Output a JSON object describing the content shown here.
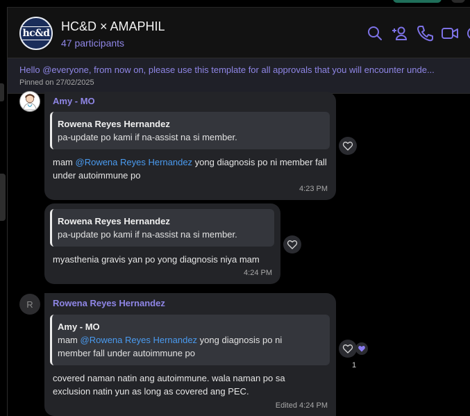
{
  "header": {
    "title": "HC&D × AMAPHIL",
    "participants": "47 participants",
    "avatar_logo": "hc&d",
    "icons": [
      "search-icon",
      "add-person-icon",
      "phone-icon",
      "video-icon",
      "more-icon"
    ]
  },
  "pinned": {
    "text": "Hello @everyone, from now on, please use this template for all approvals that you will encounter unde...",
    "date": "Pinned on 27/02/2025"
  },
  "messages": [
    {
      "sender": "Amy - MO",
      "quote_name": "Rowena Reyes Hernandez",
      "quote_text": "pa-update po kami if na-assist na si member.",
      "text_prefix": "mam ",
      "mention": "@Rowena Reyes Hernandez",
      "text_suffix": " yong diagnosis po ni member fall under autoimmune po",
      "time": "4:23 PM"
    },
    {
      "quote_name": "Rowena Reyes Hernandez",
      "quote_text": "pa-update po kami if na-assist na si member.",
      "text": "myasthenia gravis yan po yong diagnosis niya mam",
      "time": "4:24 PM"
    },
    {
      "sender": "Rowena Reyes Hernandez",
      "avatar_initial": "R",
      "quote_name": "Amy - MO",
      "quote_prefix": "mam ",
      "quote_mention": "@Rowena Reyes Hernandez",
      "quote_suffix": " yong diagnosis po ni member fall under autoimmune po",
      "text": "covered naman natin ang autoimmune. wala naman po sa exclusion natin yun as long as covered ang PEC.",
      "time": "Edited 4:24 PM",
      "reaction_count": "1"
    }
  ],
  "colors": {
    "accent": "#8f86e6",
    "mention": "#4a9bf0",
    "bubble": "#232428",
    "quote": "#34363c"
  }
}
